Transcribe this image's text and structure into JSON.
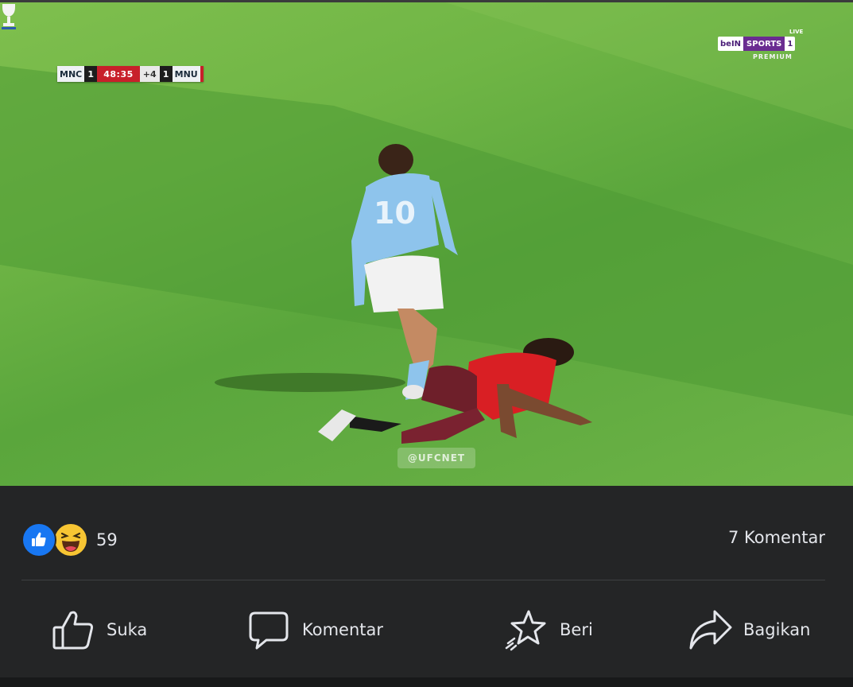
{
  "video": {
    "scoreboard": {
      "home_team": "MNC",
      "home_score": "1",
      "clock": "48:35",
      "added_time": "+4",
      "away_score": "1",
      "away_team": "MNU"
    },
    "broadcaster": {
      "brand": "beIN",
      "sports": "SPORTS",
      "channel": "1",
      "live": "LIVE",
      "tier": "PREMIUM"
    },
    "watermark": "@UFCNET"
  },
  "post": {
    "reactions": [
      "like",
      "haha"
    ],
    "reaction_count": "59",
    "comment_count": "7 Komentar"
  },
  "actions": {
    "like": "Suka",
    "comment": "Komentar",
    "give": "Beri",
    "share": "Bagikan"
  },
  "colors": {
    "background": "#242526",
    "text": "#e4e6eb",
    "like_blue": "#1877f2",
    "haha_yellow": "#f7c533"
  }
}
